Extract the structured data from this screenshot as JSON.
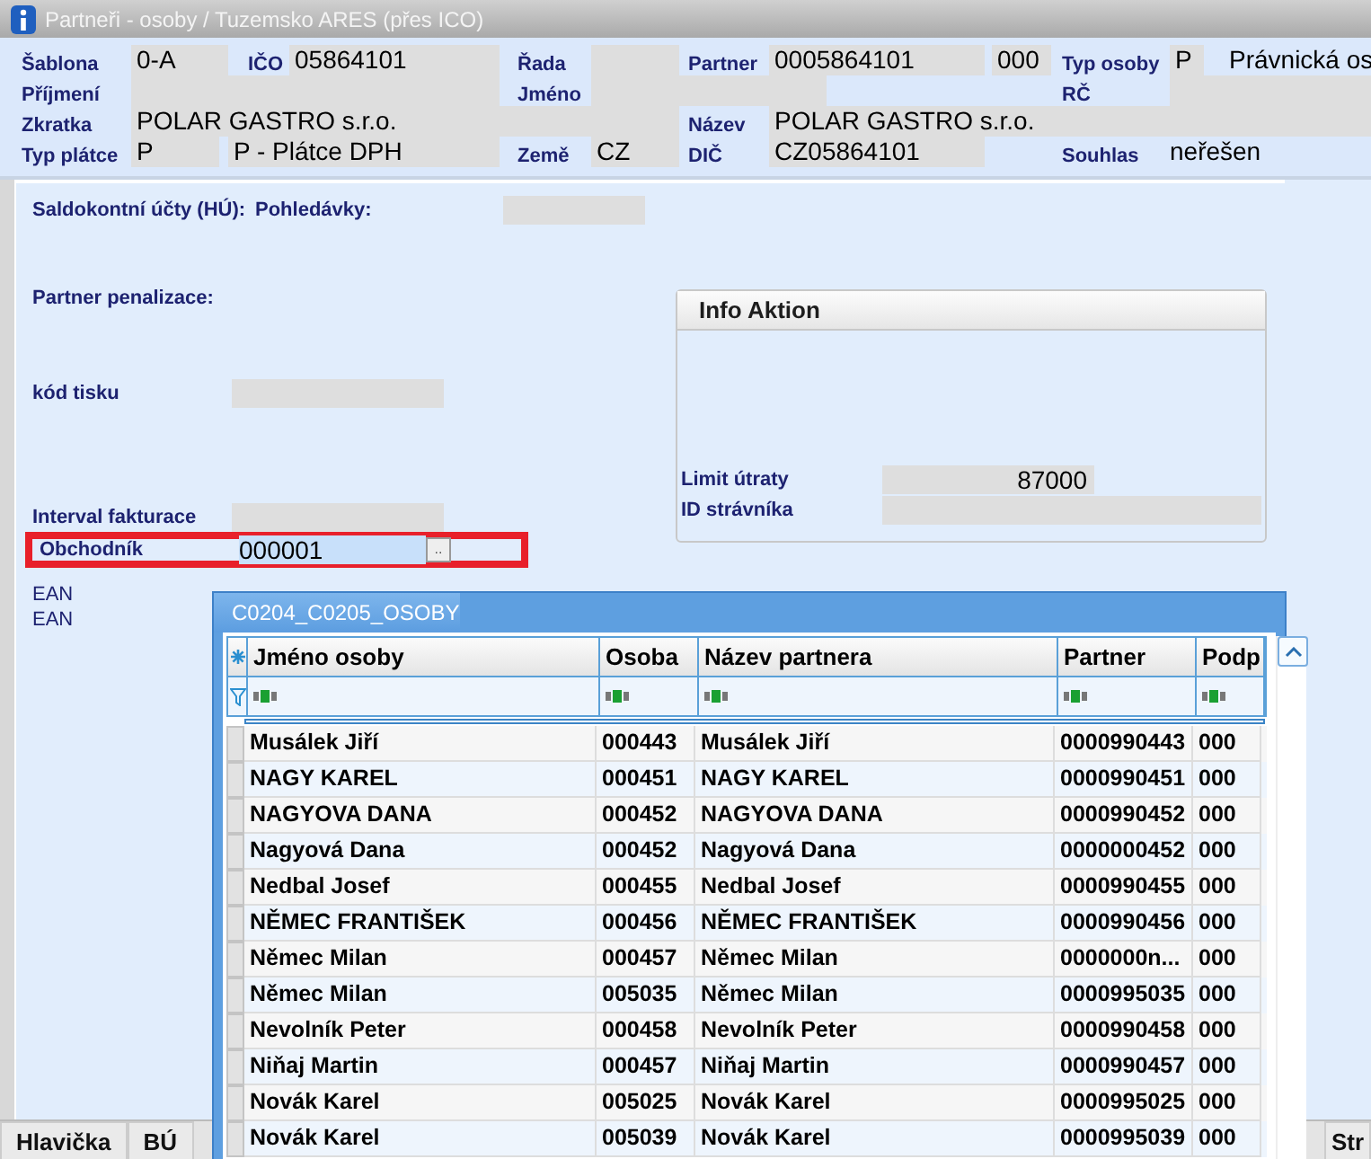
{
  "window": {
    "title": "Partneři - osoby / Tuzemsko ARES (přes ICO)"
  },
  "header": {
    "rows": [
      [
        {
          "kind": "label",
          "text": "Šablona"
        },
        {
          "kind": "field",
          "value": "0-A"
        },
        {
          "kind": "label",
          "text": "IČO"
        },
        {
          "kind": "field",
          "value": "05864101"
        },
        {
          "kind": "label",
          "text": "Řada"
        },
        {
          "kind": "field"
        },
        {
          "kind": "label",
          "text": "Partner"
        },
        {
          "kind": "field",
          "value": "0005864101"
        },
        {
          "kind": "field",
          "value": "000"
        },
        {
          "kind": "label",
          "text": "Typ osoby"
        },
        {
          "kind": "field",
          "value": "P"
        },
        {
          "kind": "text",
          "value": "Právnická os"
        }
      ],
      [
        {
          "kind": "label",
          "text": "Příjmení"
        },
        {
          "kind": "field"
        },
        "",
        "",
        {
          "kind": "label",
          "text": "Jméno"
        },
        {
          "kind": "field"
        },
        "",
        "",
        "",
        {
          "kind": "label",
          "text": "RČ"
        },
        {
          "kind": "field"
        },
        ""
      ],
      [
        {
          "kind": "label",
          "text": "Zkratka"
        },
        {
          "kind": "field",
          "value": "POLAR GASTRO s.r.o."
        },
        "",
        "",
        "",
        "",
        {
          "kind": "label",
          "text": "Název"
        },
        {
          "kind": "field",
          "value": "POLAR GASTRO s.r.o."
        },
        "",
        "",
        "",
        ""
      ],
      [
        {
          "kind": "label",
          "text": "Typ plátce"
        },
        {
          "kind": "field",
          "value": "P"
        },
        {
          "kind": "field",
          "value": "P - Plátce DPH"
        },
        "",
        {
          "kind": "label",
          "text": "Země"
        },
        {
          "kind": "field",
          "value": "CZ"
        },
        {
          "kind": "label",
          "text": "DIČ"
        },
        {
          "kind": "field",
          "value": "CZ05864101"
        },
        "",
        {
          "kind": "label",
          "text": "Souhlas"
        },
        {
          "kind": "text",
          "value": "neřešen"
        },
        ""
      ]
    ]
  },
  "form": {
    "saldo_label": "Saldokontní účty (HÚ):",
    "pohledavky_label": "Pohledávky:",
    "penalizace_label": "Partner penalizace:",
    "kod_tisku_label": "kód tisku",
    "interval_label": "Interval fakturace",
    "obchodnik": {
      "label": "Obchodník",
      "value": "000001",
      "browse": "..",
      "highlighted": true
    },
    "ean_labels": [
      "EAN",
      "EAN"
    ]
  },
  "info_aktion": {
    "title": "Info Aktion",
    "limit_label": "Limit útraty",
    "limit_value": "87000",
    "id_label": "ID strávníka"
  },
  "popup": {
    "title": "C0204_C0205_OSOBY",
    "columns": [
      "Jméno osoby",
      "Osoba",
      "Název partnera",
      "Partner",
      "Podp"
    ],
    "rows": [
      [
        "Musálek Jiří",
        "000443",
        "Musálek Jiří",
        "0000990443",
        "000"
      ],
      [
        "NAGY KAREL",
        "000451",
        "NAGY KAREL",
        "0000990451",
        "000"
      ],
      [
        "NAGYOVA DANA",
        "000452",
        "NAGYOVA DANA",
        "0000990452",
        "000"
      ],
      [
        "Nagyová Dana",
        "000452",
        "Nagyová Dana",
        "0000000452",
        "000"
      ],
      [
        "Nedbal Josef",
        "000455",
        "Nedbal Josef",
        "0000990455",
        "000"
      ],
      [
        "NĚMEC FRANTIŠEK",
        "000456",
        "NĚMEC FRANTIŠEK",
        "0000990456",
        "000"
      ],
      [
        "Němec Milan",
        "000457",
        "Němec Milan",
        "0000000n...",
        "000"
      ],
      [
        "Němec Milan",
        "005035",
        "Němec Milan",
        "0000995035",
        "000"
      ],
      [
        "Nevolník Peter",
        "000458",
        "Nevolník Peter",
        "0000990458",
        "000"
      ],
      [
        "Niňaj Martin",
        "000457",
        "Niňaj Martin",
        "0000990457",
        "000"
      ],
      [
        "Novák Karel",
        "005025",
        "Novák Karel",
        "0000995025",
        "000"
      ],
      [
        "Novák Karel",
        "005039",
        "Novák Karel",
        "0000995039",
        "000"
      ]
    ]
  },
  "bottom_tabs": [
    {
      "label": "Hlavička"
    },
    {
      "label": "BÚ"
    }
  ],
  "right_tab": {
    "label": "Str"
  }
}
